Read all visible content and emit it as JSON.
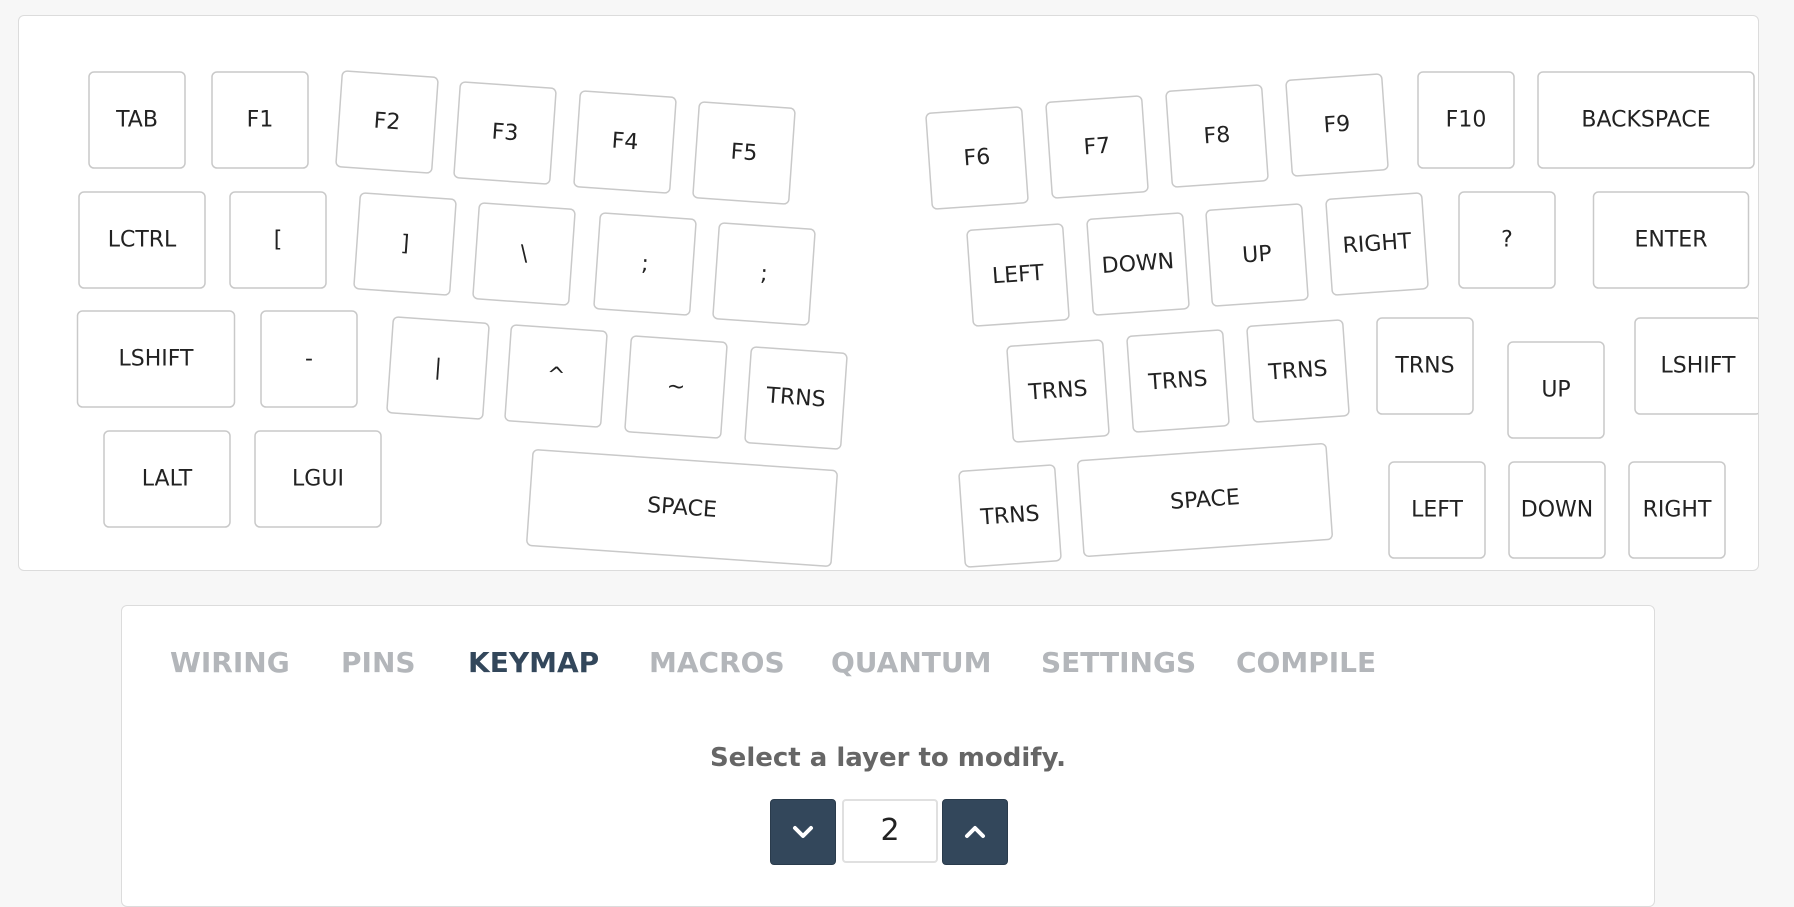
{
  "keyboard": {
    "left": [
      "TAB",
      "F1",
      "F2",
      "F3",
      "F4",
      "F5",
      "LCTRL",
      "[",
      "]",
      "\\",
      ";",
      ";",
      "LSHIFT",
      "-",
      "|",
      "^",
      "~",
      "TRNS",
      "LALT",
      "LGUI",
      "SPACE"
    ],
    "right": [
      "F6",
      "F7",
      "F8",
      "F9",
      "F10",
      "BACKSPACE",
      "LEFT",
      "DOWN",
      "UP",
      "RIGHT",
      "?",
      "ENTER",
      "TRNS",
      "TRNS",
      "TRNS",
      "TRNS",
      "UP",
      "LSHIFT",
      "TRNS",
      "SPACE",
      "LEFT",
      "DOWN",
      "RIGHT"
    ]
  },
  "tabs": [
    "WIRING",
    "PINS",
    "KEYMAP",
    "MACROS",
    "QUANTUM",
    "SETTINGS",
    "COMPILE"
  ],
  "active_tab": "KEYMAP",
  "layer": {
    "prompt": "Select a layer to modify.",
    "value": "2",
    "down_icon": "chevron-down-icon",
    "up_icon": "chevron-up-icon"
  },
  "colors": {
    "accent": "#33475b",
    "tab_inactive": "#b3b6ba",
    "key_border": "#c9c9c9"
  }
}
